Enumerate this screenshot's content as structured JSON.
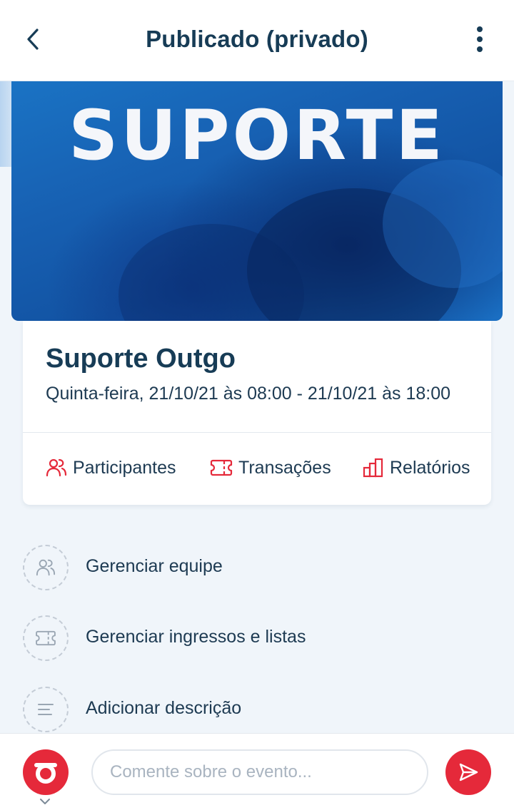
{
  "header": {
    "title": "Publicado (privado)",
    "back_icon": "chevron-left-icon",
    "menu_icon": "more-vertical-icon"
  },
  "banner": {
    "text": "SUPORTE"
  },
  "event": {
    "name": "Suporte Outgo",
    "date": "Quinta-feira, 21/10/21 às 08:00 - 21/10/21 às 18:00"
  },
  "actions": [
    {
      "label": "Participantes",
      "icon": "users-icon"
    },
    {
      "label": "Transações",
      "icon": "ticket-icon"
    },
    {
      "label": "Relatórios",
      "icon": "bar-chart-icon"
    }
  ],
  "menu": [
    {
      "label": "Gerenciar equipe",
      "icon": "users-icon"
    },
    {
      "label": "Gerenciar ingressos e listas",
      "icon": "ticket-icon"
    },
    {
      "label": "Adicionar descrição",
      "icon": "text-lines-icon"
    }
  ],
  "comment": {
    "placeholder": "Comente sobre o evento..."
  },
  "colors": {
    "accent": "#e5293a",
    "primary_text": "#173c56",
    "background": "#f0f5fa"
  }
}
